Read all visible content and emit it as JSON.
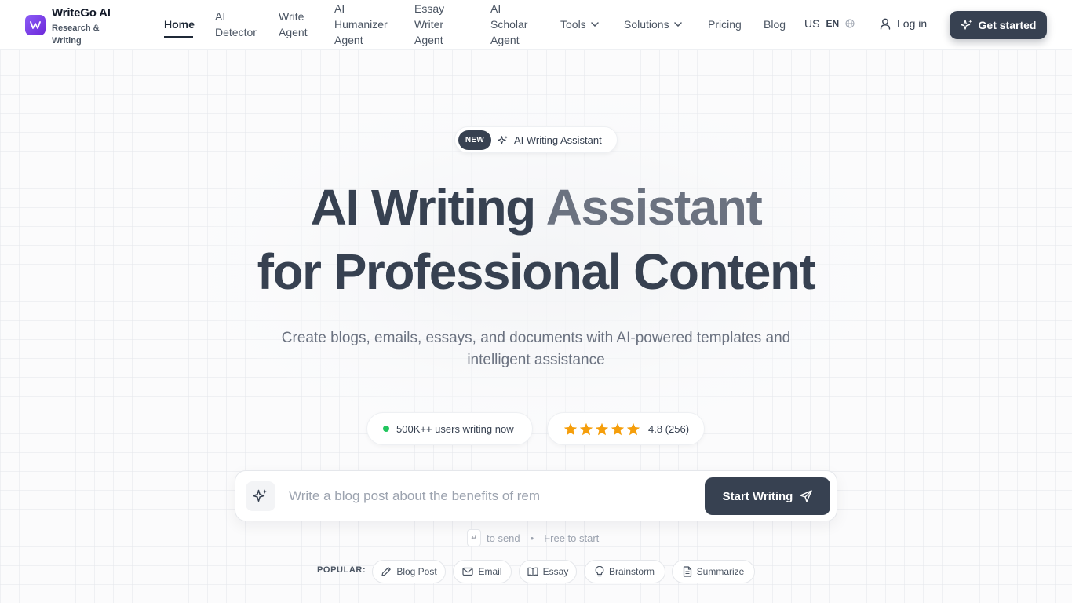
{
  "brand": {
    "name": "WriteGo AI",
    "tagline": "Research & Writing"
  },
  "nav": {
    "home": "Home",
    "ai_detector": "AI Detector",
    "write_agent": "Write Agent",
    "ai_humanizer_agent": "AI Humanizer Agent",
    "essay_writer_agent": "Essay Writer Agent",
    "ai_scholar_agent": "AI Scholar Agent",
    "tools": "Tools",
    "solutions": "Solutions",
    "pricing": "Pricing",
    "blog": "Blog",
    "region": "US",
    "language": "EN",
    "login": "Log in",
    "get_started": "Get started"
  },
  "hero": {
    "badge_new": "NEW",
    "badge_text": "AI Writing Assistant",
    "title_part1": "AI Writing",
    "title_part2": "Assistant",
    "title_line2": "for Professional Content",
    "subtitle": "Create blogs, emails, essays, and documents with AI-powered templates and intelligent assistance"
  },
  "stats": {
    "users": "500K++ users writing now",
    "rating": "4.8 (256)",
    "stars": 5
  },
  "prompt": {
    "value": "Write a blog post about the benefits of rem",
    "button": "Start Writing",
    "enter_key": "↵",
    "send_hint": "to send",
    "separator": "•",
    "free_hint": "Free to start"
  },
  "popular": {
    "label": "POPULAR:",
    "chips": [
      "Blog Post",
      "Email",
      "Essay",
      "Brainstorm",
      "Summarize"
    ]
  },
  "colors": {
    "primary_dark": "#374151",
    "brand_purple": "#7c3aed",
    "star": "#f59e0b",
    "online": "#22c55e"
  }
}
